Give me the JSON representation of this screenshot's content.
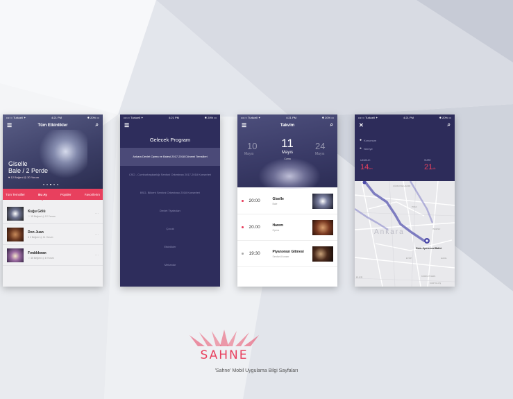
{
  "colors": {
    "accent": "#e8405e",
    "navy": "#2e2d5c",
    "background": "#f3f4f6"
  },
  "statusbar": {
    "carrier": "•••○○ Turkcell ✦",
    "time": "4:21 PM",
    "battery": "✱ 20% ▭"
  },
  "screen1": {
    "nav_title": "Tüm Etkinlikler",
    "hero_title_line1": "Giselle",
    "hero_title_line2": "Bale / 2 Perde",
    "hero_meta": "♥ 12 Beğeni   ◎ 30 Yorum",
    "tabs": [
      "Tüm Temsiller",
      "Bu Ay",
      "Popüler",
      "Favorilerim"
    ],
    "active_tab": "Bu Ay",
    "events": [
      {
        "name": "Kuğu Gölü",
        "meta": "♡ 15 Beğeni  ◎ 12 Yorum"
      },
      {
        "name": "Don Juan",
        "meta": "♥ 2 Beğeni  ◎ 11 Yorum"
      },
      {
        "name": "Fındıkkıran",
        "meta": "♡ 45 Beğeni  ◎ 8 Yorum"
      }
    ]
  },
  "screen2": {
    "title": "Gelecek Program",
    "menu": [
      "Ankara Devlet Opera ve Balesi 2017-2018 Dönemi Temsilleri",
      "CSO - Cumhurbaşkanlığı Senfoni Orkestrası 2017-2018 Konserleri",
      "BSO- Bilkent Senfoni Orkestrası 2018 Konserleri",
      "Devlet Tiyatroları",
      "Çocuk",
      "Etkinlikler",
      "Mekanlar"
    ]
  },
  "screen3": {
    "nav_title": "Takvim",
    "prev_day": "10",
    "prev_month": "Mayıs",
    "day": "11",
    "month": "Mayıs",
    "weekday": "Cuma",
    "next_day": "24",
    "next_month": "Mayıs",
    "schedule": [
      {
        "time": "20:00",
        "name": "Giselle",
        "sub": "Bale"
      },
      {
        "time": "20.00",
        "name": "Harem",
        "sub": "Opera"
      },
      {
        "time": "19:30",
        "name": "Piyanonun Gitmesi",
        "sub": "Senfoni Konser"
      }
    ]
  },
  "screen4": {
    "origin": "Konumum",
    "destination": "Nereye",
    "distance_label": "UZAKLIK",
    "distance_value": "14",
    "distance_unit": "km",
    "duration_label": "SÜRE",
    "duration_value": "21",
    "duration_unit": "dk",
    "map_city": "Ankara",
    "map_destination": "State Opera and Ballet",
    "map_labels": [
      "ÇÜREYDE HANIM",
      "PAŞA",
      "İNCESU",
      "EYÜP",
      "HACE",
      "ELER",
      "KORKUT REİS",
      "KURTULUŞ"
    ]
  },
  "brand": {
    "logo_text": "SAHNE",
    "tagline": "'Sahne' Mobil Uygulama Bilgi Sayfaları"
  }
}
